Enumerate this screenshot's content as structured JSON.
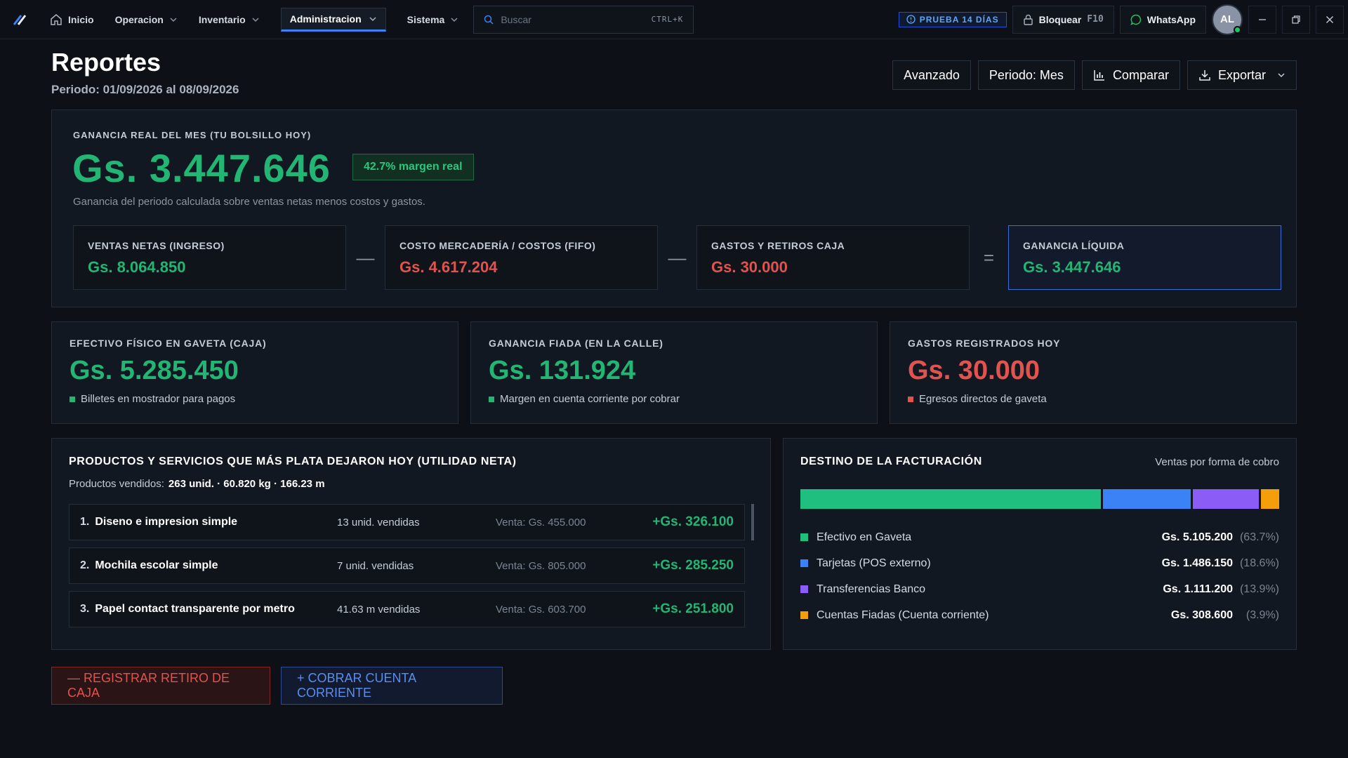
{
  "nav": {
    "items": [
      {
        "label": "Inicio"
      },
      {
        "label": "Operacion"
      },
      {
        "label": "Inventario"
      },
      {
        "label": "Administracion"
      },
      {
        "label": "Sistema"
      }
    ],
    "search_placeholder": "Buscar",
    "search_shortcut": "CTRL+K",
    "trial_label": "PRUEBA 14 DÍAS",
    "lock_label": "Bloquear",
    "lock_shortcut": "F10",
    "whatsapp_label": "WhatsApp",
    "avatar_initials": "AL"
  },
  "header": {
    "title": "Reportes",
    "period": "Periodo: 01/09/2026 al 08/09/2026",
    "actions": {
      "advanced": "Avanzado",
      "period_select": "Periodo: Mes",
      "compare": "Comparar",
      "export": "Exportar"
    }
  },
  "hero": {
    "label": "GANANCIA REAL DEL MES (TU BOLSILLO HOY)",
    "value": "Gs. 3.447.646",
    "badge": "42.7% margen real",
    "description": "Ganancia del periodo calculada sobre ventas netas menos costos y gastos.",
    "equation": [
      {
        "label": "VENTAS NETAS (INGRESO)",
        "value": "Gs. 8.064.850"
      },
      {
        "label": "COSTO MERCADERÍA / COSTOS (FIFO)",
        "value": "Gs. 4.617.204"
      },
      {
        "label": "GASTOS Y RETIROS CAJA",
        "value": "Gs. 30.000"
      },
      {
        "label": "GANANCIA LÍQUIDA",
        "value": "Gs. 3.447.646"
      }
    ],
    "operators": [
      "—",
      "—",
      "="
    ]
  },
  "cards": [
    {
      "label": "EFECTIVO FÍSICO EN GAVETA (CAJA)",
      "value": "Gs. 5.285.450",
      "sub": "Billetes en mostrador para pagos"
    },
    {
      "label": "GANANCIA FIADA (EN LA CALLE)",
      "value": "Gs. 131.924",
      "sub": "Margen en cuenta corriente por cobrar"
    },
    {
      "label": "GASTOS REGISTRADOS HOY",
      "value": "Gs. 30.000",
      "sub": "Egresos directos de gaveta"
    }
  ],
  "products": {
    "title": "PRODUCTOS Y SERVICIOS QUE MÁS PLATA DEJARON HOY (UTILIDAD NETA)",
    "sold_label": "Productos vendidos:",
    "sold_value": "263 unid. · 60.820 kg · 166.23 m",
    "rows": [
      {
        "num": "1.",
        "name": "Diseno e impresion simple",
        "qty": "13 unid. vendidas",
        "sale": "Venta: Gs. 455.000",
        "profit": "+Gs. 326.100"
      },
      {
        "num": "2.",
        "name": "Mochila escolar simple",
        "qty": "7 unid. vendidas",
        "sale": "Venta: Gs. 805.000",
        "profit": "+Gs. 285.250"
      },
      {
        "num": "3.",
        "name": "Papel contact transparente por metro",
        "qty": "41.63 m vendidas",
        "sale": "Venta: Gs. 603.700",
        "profit": "+Gs. 251.800"
      }
    ]
  },
  "billing": {
    "title": "DESTINO DE LA FACTURACIÓN",
    "note": "Ventas por forma de cobro",
    "items": [
      {
        "name": "Efectivo en Gaveta",
        "amount": "Gs. 5.105.200",
        "pct_label": "(63.7%)",
        "share": 63.7,
        "color": "#1fbf7f"
      },
      {
        "name": "Tarjetas (POS externo)",
        "amount": "Gs. 1.486.150",
        "pct_label": "(18.6%)",
        "share": 18.6,
        "color": "#3b82f6"
      },
      {
        "name": "Transferencias Banco",
        "amount": "Gs. 1.111.200",
        "pct_label": "(13.9%)",
        "share": 13.9,
        "color": "#8b5cf6"
      },
      {
        "name": "Cuentas Fiadas (Cuenta corriente)",
        "amount": "Gs. 308.600",
        "pct_label": "(3.9%)",
        "share": 3.9,
        "color": "#f59e0b"
      }
    ]
  },
  "actions": {
    "withdraw": "— REGISTRAR RETIRO DE CAJA",
    "collect": "+ COBRAR CUENTA CORRIENTE"
  }
}
